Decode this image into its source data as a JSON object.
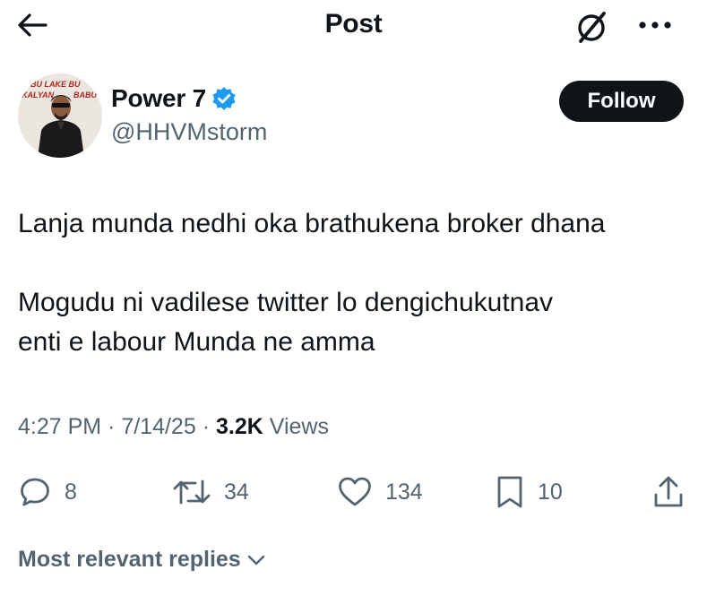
{
  "header": {
    "title": "Post",
    "back_icon": "arrow-left-icon",
    "grok_icon": "grok-icon",
    "more_icon": "more-dots-icon"
  },
  "author": {
    "display_name": "Power 7",
    "handle": "@HHVMstorm",
    "verified": true,
    "verified_color": "#1d9bf0",
    "avatar_caption": "BU LAKE BU KALYAN BABU"
  },
  "follow_button": {
    "label": "Follow"
  },
  "post": {
    "paragraph_1": "Lanja munda nedhi oka brathukena broker dhana",
    "paragraph_2_line_1": "Mogudu ni vadilese twitter lo dengichukutnav",
    "paragraph_2_line_2": "enti e labour Munda ne amma"
  },
  "meta": {
    "time": "4:27 PM",
    "separator": " · ",
    "date": "7/14/25",
    "views_count": "3.2K",
    "views_label": " Views"
  },
  "actions": {
    "replies": "8",
    "reposts": "34",
    "likes": "134",
    "bookmarks": "10"
  },
  "replies_sort": {
    "label": "Most relevant replies"
  },
  "colors": {
    "text_primary": "#0f1419",
    "text_secondary": "#536471",
    "follow_bg": "#0f1419",
    "background": "#ffffff"
  }
}
